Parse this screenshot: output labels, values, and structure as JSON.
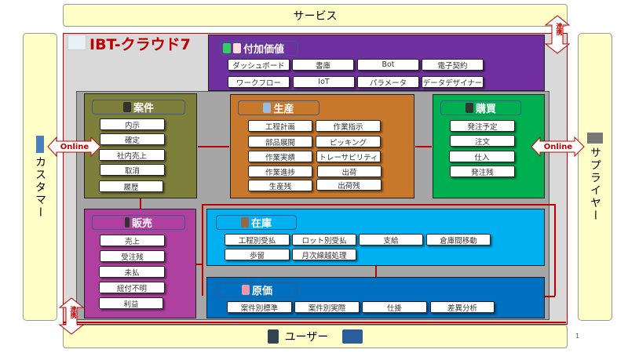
{
  "service": "サービス",
  "customer": "カスタマー",
  "supplier": "サプライヤー",
  "user": "ユーザー",
  "title": "IBT-クラウド7",
  "page_number": "1",
  "online_left": "Online",
  "online_right": "Online",
  "renkei_top": "連携",
  "renkei_bottom": "連携",
  "value_added": {
    "title": "付加価値",
    "items": [
      "ダッシュボード",
      "書庫",
      "Bot",
      "電子契約",
      "ワークフロー",
      "IoT",
      "パラメータ",
      "データデザイナー"
    ],
    "color": "#7030a0"
  },
  "anken": {
    "title": "案件",
    "items": [
      "内示",
      "確定",
      "社内売上",
      "取消",
      "履歴"
    ],
    "color": "#7f7f3c"
  },
  "seisan": {
    "title": "生産",
    "items": [
      "工程計画",
      "作業指示",
      "部品展開",
      "ピッキング",
      "作業実績",
      "トレーサビリティ",
      "作業進捗",
      "出荷",
      "生産残",
      "出荷残"
    ],
    "color": "#c8782a"
  },
  "kobai": {
    "title": "購買",
    "items": [
      "発注予定",
      "注文",
      "仕入",
      "発注残"
    ],
    "color": "#00b050"
  },
  "hanbai": {
    "title": "販売",
    "items": [
      "売上",
      "受注残",
      "未払",
      "紐付不明",
      "利益"
    ],
    "color": "#b040a0"
  },
  "zaiko": {
    "title": "在庫",
    "items": [
      "工程別受払",
      "ロット別受払",
      "支給",
      "倉庫間移動",
      "歩留",
      "月次繰越処理"
    ],
    "color": "#00b0f0"
  },
  "genka": {
    "title": "原価",
    "items": [
      "案件別標準",
      "案件別実際",
      "仕掛",
      "差異分析"
    ],
    "color": "#0070c0"
  }
}
